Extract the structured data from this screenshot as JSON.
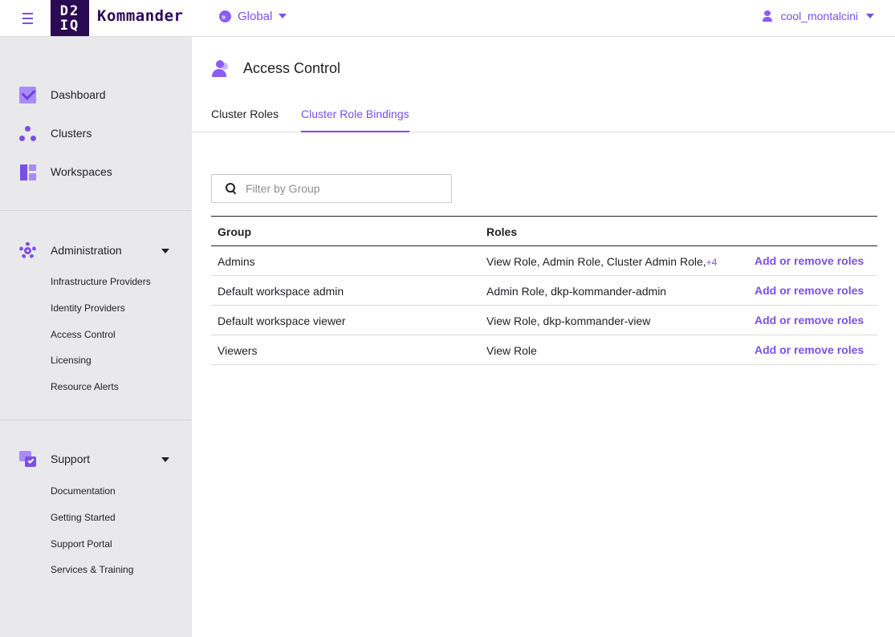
{
  "header": {
    "logo_line1": "D2",
    "logo_line2": "IQ",
    "brand": "Kommander",
    "scope_label": "Global",
    "username": "cool_montalcini"
  },
  "sidebar": {
    "main_items": [
      {
        "label": "Dashboard",
        "icon": "dashboard-icon"
      },
      {
        "label": "Clusters",
        "icon": "clusters-icon"
      },
      {
        "label": "Workspaces",
        "icon": "workspaces-icon"
      }
    ],
    "administration": {
      "label": "Administration",
      "icon": "gear-icon",
      "items": [
        "Infrastructure Providers",
        "Identity Providers",
        "Access Control",
        "Licensing",
        "Resource Alerts"
      ]
    },
    "support": {
      "label": "Support",
      "icon": "support-icon",
      "items": [
        "Documentation",
        "Getting Started",
        "Support Portal",
        "Services & Training"
      ]
    }
  },
  "page": {
    "title": "Access Control",
    "tabs": [
      {
        "label": "Cluster Roles",
        "active": false
      },
      {
        "label": "Cluster Role Bindings",
        "active": true
      }
    ],
    "filter_placeholder": "Filter by Group"
  },
  "table": {
    "columns": [
      "Group",
      "Roles"
    ],
    "rows": [
      {
        "group": "Admins",
        "roles": "View Role, Admin Role, Cluster Admin Role,",
        "more": "+4",
        "action": "Add or remove roles"
      },
      {
        "group": "Default workspace admin",
        "roles": "Admin Role, dkp-kommander-admin",
        "more": "",
        "action": "Add or remove roles"
      },
      {
        "group": "Default workspace viewer",
        "roles": "View Role, dkp-kommander-view",
        "more": "",
        "action": "Add or remove roles"
      },
      {
        "group": "Viewers",
        "roles": "View Role",
        "more": "",
        "action": "Add or remove roles"
      }
    ]
  },
  "colors": {
    "accent": "#7b4fe6",
    "brand_dark": "#2a0a52",
    "sidebar_bg": "#e9e9ec"
  }
}
